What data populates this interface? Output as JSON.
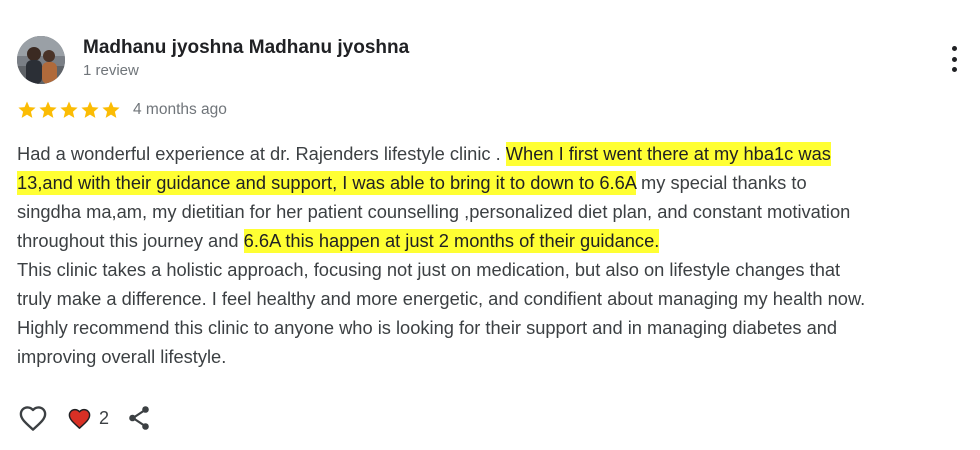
{
  "review": {
    "author_name": "Madhanu jyoshna Madhanu jyoshna",
    "author_meta": "1 review",
    "rating": 5,
    "rating_max": 5,
    "time_ago": "4 months ago",
    "lines": [
      [
        {
          "text": "Had a wonderful experience at dr. Rajenders lifestyle clinic . ",
          "highlight": false
        },
        {
          "text": "When I first went there at my hba1c was",
          "highlight": true
        }
      ],
      [
        {
          "text": "13,and with their guidance and support, I was able to bring it to down to 6.6A",
          "highlight": true
        },
        {
          "text": " my special thanks to",
          "highlight": false
        }
      ],
      [
        {
          "text": "singdha ma,am, my dietitian for her patient counselling ,personalized diet plan, and constant motivation",
          "highlight": false
        }
      ],
      [
        {
          "text": "throughout this journey and ",
          "highlight": false
        },
        {
          "text": "6.6A this happen at just 2 months of their guidance.",
          "highlight": true
        }
      ],
      [
        {
          "text": "This clinic takes a holistic approach, focusing not just on medication, but also on lifestyle changes that",
          "highlight": false
        }
      ],
      [
        {
          "text": "truly make a difference. I feel healthy and more energetic, and condifient about managing my health now.",
          "highlight": false
        }
      ],
      [
        {
          "text": "Highly recommend this clinic to anyone who is looking for their support and in managing diabetes and",
          "highlight": false
        }
      ],
      [
        {
          "text": "improving overall lifestyle.",
          "highlight": false
        }
      ]
    ],
    "reaction_count": "2"
  },
  "icons": {
    "star": "star-icon",
    "more": "more-vert-icon",
    "like": "heart-outline-icon",
    "reaction": "heart-filled-icon",
    "share": "share-icon"
  },
  "colors": {
    "star": "#fbbc04",
    "highlight": "#ffff33",
    "heart_fill": "#d93025",
    "text": "#3c4043",
    "name": "#202124",
    "meta": "#70757a"
  }
}
